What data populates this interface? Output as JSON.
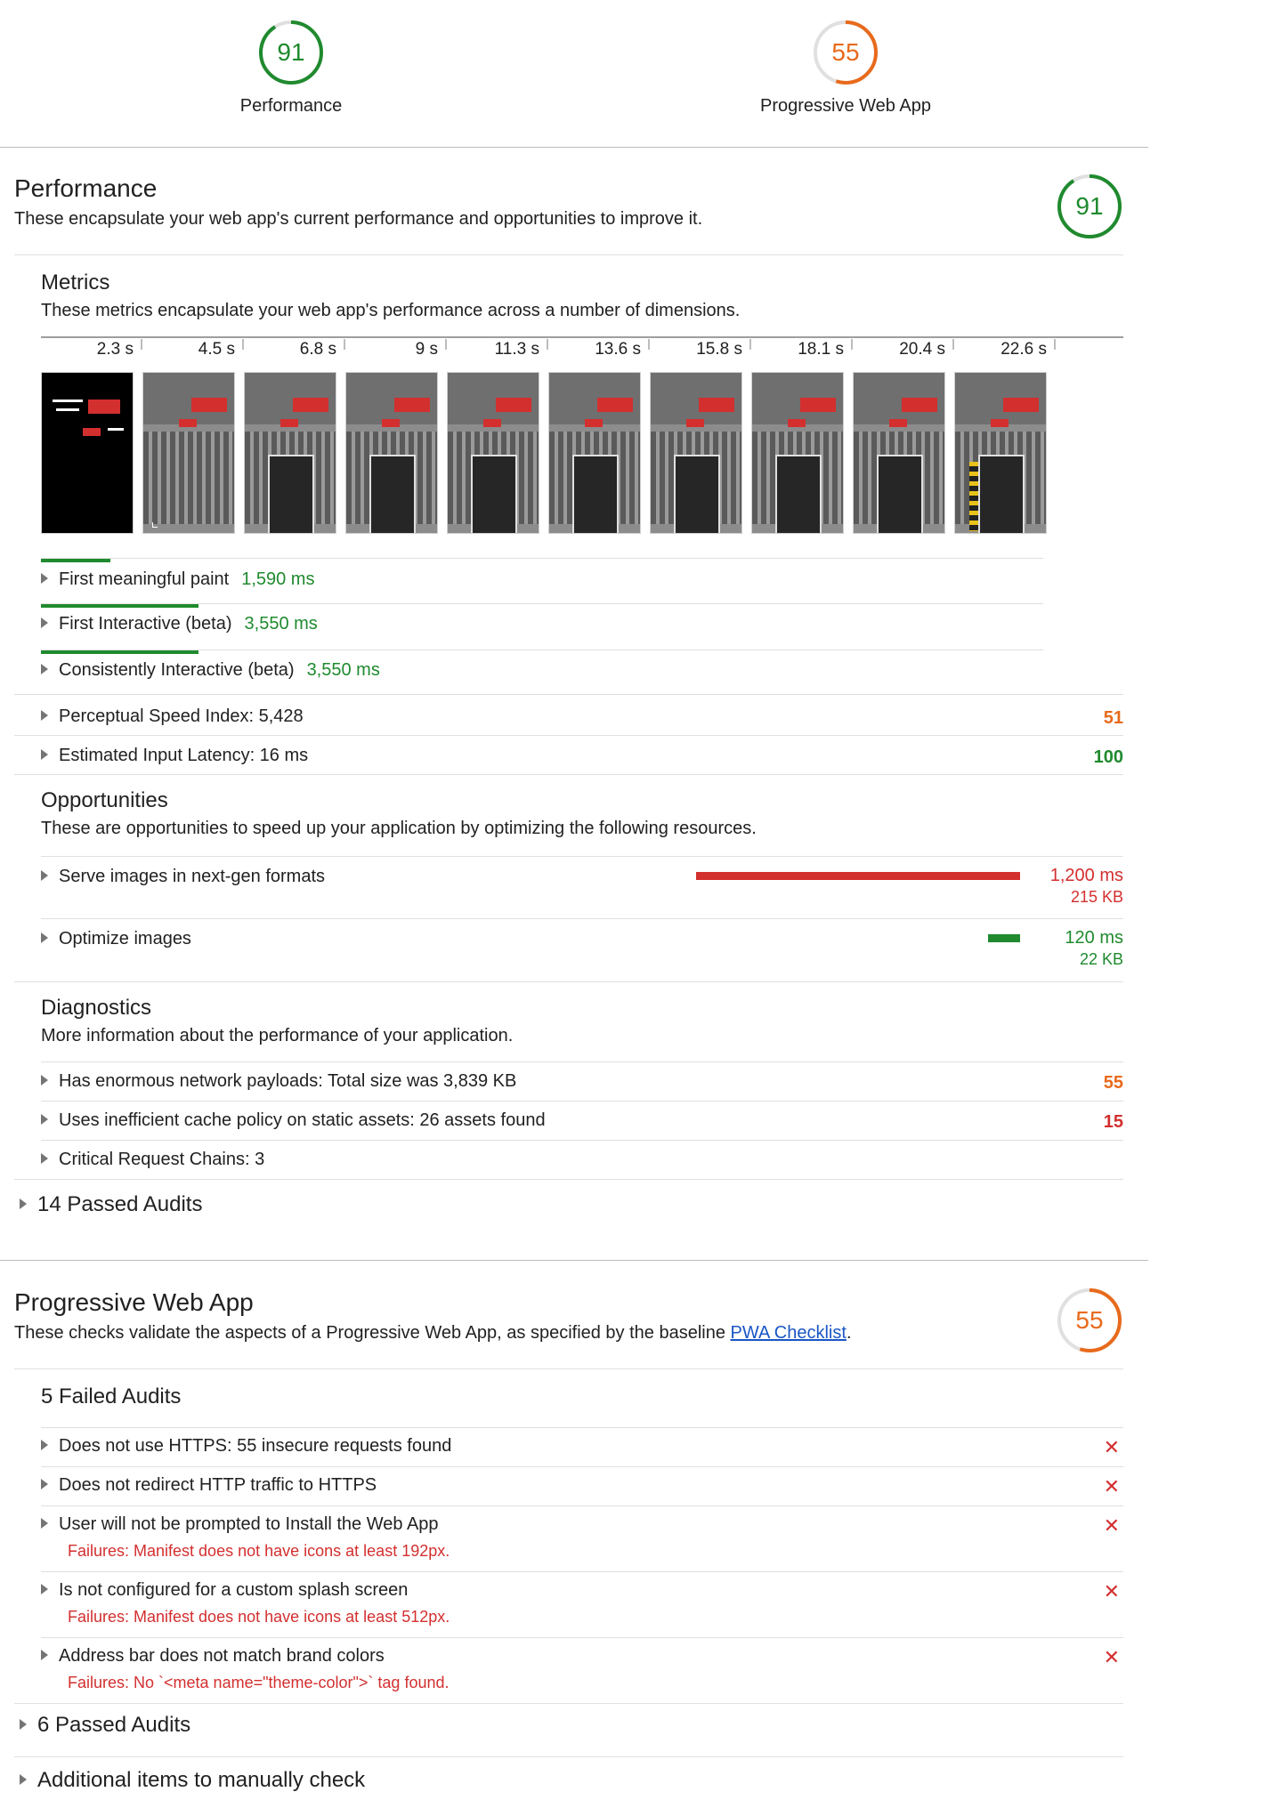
{
  "summary": {
    "gauges": [
      {
        "label": "Performance",
        "score": "91",
        "value": 0.91,
        "color": "#1f8a2e"
      },
      {
        "label": "Progressive Web App",
        "score": "55",
        "value": 0.55,
        "color": "#e86a1c"
      }
    ]
  },
  "performance": {
    "title": "Performance",
    "description": "These encapsulate your web app's current performance and opportunities to improve it.",
    "score": "91",
    "score_value": 0.91,
    "score_color": "#1f8a2e",
    "metrics": {
      "title": "Metrics",
      "description": "These metrics encapsulate your web app's performance across a number of dimensions.",
      "timeline": [
        "2.3 s",
        "4.5 s",
        "6.8 s",
        "9 s",
        "11.3 s",
        "13.6 s",
        "15.8 s",
        "18.1 s",
        "20.4 s",
        "22.6 s"
      ],
      "items": [
        {
          "label": "First meaningful paint",
          "value": "1,590 ms",
          "fraction": 0.069
        },
        {
          "label": "First Interactive (beta)",
          "value": "3,550 ms",
          "fraction": 0.157
        },
        {
          "label": "Consistently Interactive (beta)",
          "value": "3,550 ms",
          "fraction": 0.157
        }
      ],
      "scored": [
        {
          "label": "Perceptual Speed Index: 5,428",
          "score": "51",
          "color": "#e86a1c"
        },
        {
          "label": "Estimated Input Latency: 16 ms",
          "score": "100",
          "color": "#1f8a2e"
        }
      ]
    },
    "opportunities": {
      "title": "Opportunities",
      "description": "These are opportunities to speed up your application by optimizing the following resources.",
      "items": [
        {
          "label": "Serve images in next-gen formats",
          "time": "1,200 ms",
          "size": "215 KB",
          "fraction": 1.0,
          "color": "#d32f2f"
        },
        {
          "label": "Optimize images",
          "time": "120 ms",
          "size": "22 KB",
          "fraction": 0.1,
          "color": "#1f8a2e"
        }
      ]
    },
    "diagnostics": {
      "title": "Diagnostics",
      "description": "More information about the performance of your application.",
      "items": [
        {
          "label": "Has enormous network payloads: Total size was 3,839 KB",
          "score": "55",
          "color": "#e86a1c"
        },
        {
          "label": "Uses inefficient cache policy on static assets: 26 assets found",
          "score": "15",
          "color": "#d32f2f"
        },
        {
          "label": "Critical Request Chains: 3",
          "score": ""
        }
      ]
    },
    "passed": "14 Passed Audits"
  },
  "pwa": {
    "title": "Progressive Web App",
    "description_before": "These checks validate the aspects of a Progressive Web App, as specified by the baseline ",
    "link_text": "PWA Checklist",
    "description_after": ".",
    "score": "55",
    "score_value": 0.55,
    "score_color": "#e86a1c",
    "failed_title": "5 Failed Audits",
    "failed": [
      {
        "label": "Does not use HTTPS: 55 insecure requests found",
        "detail": ""
      },
      {
        "label": "Does not redirect HTTP traffic to HTTPS",
        "detail": ""
      },
      {
        "label": "User will not be prompted to Install the Web App",
        "detail": "Failures: Manifest does not have icons at least 192px."
      },
      {
        "label": "Is not configured for a custom splash screen",
        "detail": "Failures: Manifest does not have icons at least 512px."
      },
      {
        "label": "Address bar does not match brand colors",
        "detail": "Failures: No `<meta name=\"theme-color\">` tag found."
      }
    ],
    "fail_mark": "✕",
    "passed": "6 Passed Audits",
    "manual": "Additional items to manually check"
  }
}
